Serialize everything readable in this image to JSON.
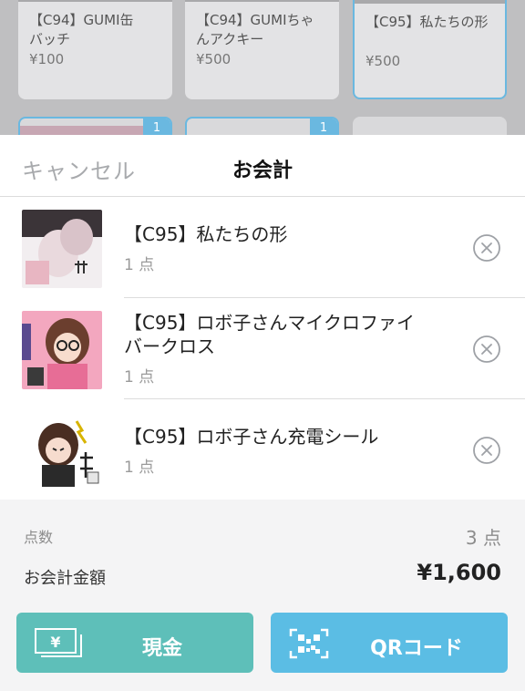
{
  "background_grid": {
    "tiles": [
      {
        "name": "【C94】GUMI缶\nバッチ",
        "price": "¥100"
      },
      {
        "name": "【C94】GUMIちゃ\nんアクキー",
        "price": "¥500"
      },
      {
        "name": "【C95】私たちの形",
        "price": "¥500",
        "selected": true
      }
    ],
    "badges": [
      "1",
      "1"
    ]
  },
  "sheet": {
    "cancel_label": "キャンセル",
    "title": "お会計",
    "items": [
      {
        "name": "【C95】私たちの形",
        "qty": "1 点"
      },
      {
        "name": "【C95】ロボ子さんマイクロファイバークロス",
        "qty": "1 点"
      },
      {
        "name": "【C95】ロボ子さん充電シール",
        "qty": "1 点"
      }
    ],
    "summary": {
      "count_label": "点数",
      "count_value": "3 点",
      "total_label": "お会計金額",
      "total_value": "¥1,600"
    },
    "buttons": {
      "cash_label": "現金",
      "cash_icon_glyph": "¥",
      "qr_label": "QRコード"
    }
  },
  "colors": {
    "cash_button": "#5ebfb9",
    "qr_button": "#5bbde4",
    "selected_border": "#6ab8e0"
  }
}
